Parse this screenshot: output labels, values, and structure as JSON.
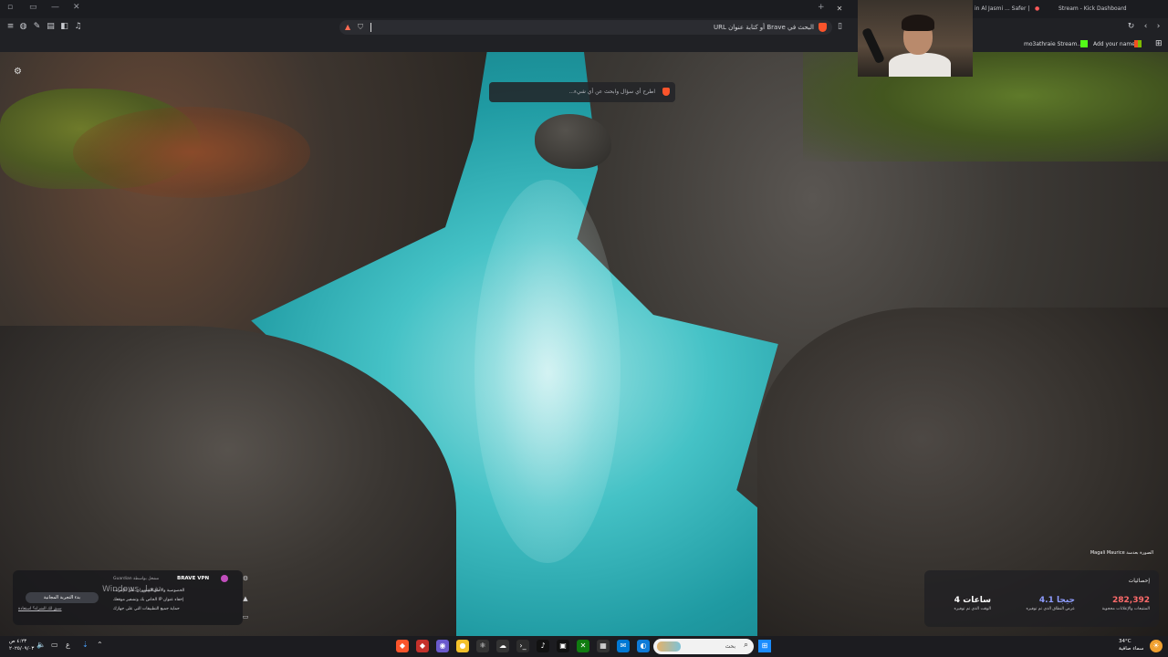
{
  "browser": {
    "tabs": [
      {
        "label": "Stream - Kick Dashboard"
      },
      {
        "label": "in Al Jasmi ... Safer |"
      }
    ],
    "address_placeholder": "البحث في Brave أو كتابة عنوان URL",
    "bookmarks": [
      {
        "label": "mo3athraie Stream..."
      },
      {
        "label": "Add your name"
      }
    ]
  },
  "newtab": {
    "search_placeholder": "اطرح أي سؤال وابحث عن أي شيء...",
    "photo_credit": "الصورة بعدسة Magali Maurice",
    "stats": {
      "title": "إحصائيات",
      "items": [
        {
          "value": "282,392",
          "label": "المتتبعات والإعلانات محجوبة",
          "color": "#ff6b6b"
        },
        {
          "value": "4.1 جيجا",
          "label": "عرض النطاق الذي تم توفيره",
          "color": "#8f9dff"
        },
        {
          "value": "4 ساعات",
          "label": "الوقت الذي تم توفيره",
          "color": "#ffffff"
        }
      ]
    }
  },
  "vpn_popup": {
    "title": "BRAVE VPN",
    "powered_by": "مشغل بواسطة Guardian",
    "lines": [
      "الخصوصية والأمان المتميزان على الإنترنت",
      "إخفاء عنوان IP الخاص بك وتشفير موقعك",
      "حماية جميع التطبيقات التي على جهازك"
    ],
    "cta": "بدء التجربة المجانية",
    "link": "سبق لك الشراء؟ استعادة",
    "watermark": "Windows تفعيل"
  },
  "taskbar": {
    "search_label": "بحث",
    "clock_time": "٤:٢٣ ص",
    "clock_date": "٢٠٢٥/٠٩/٠٣",
    "weather_temp": "34°C",
    "weather_desc": "سماء صافية",
    "language": "ع"
  }
}
